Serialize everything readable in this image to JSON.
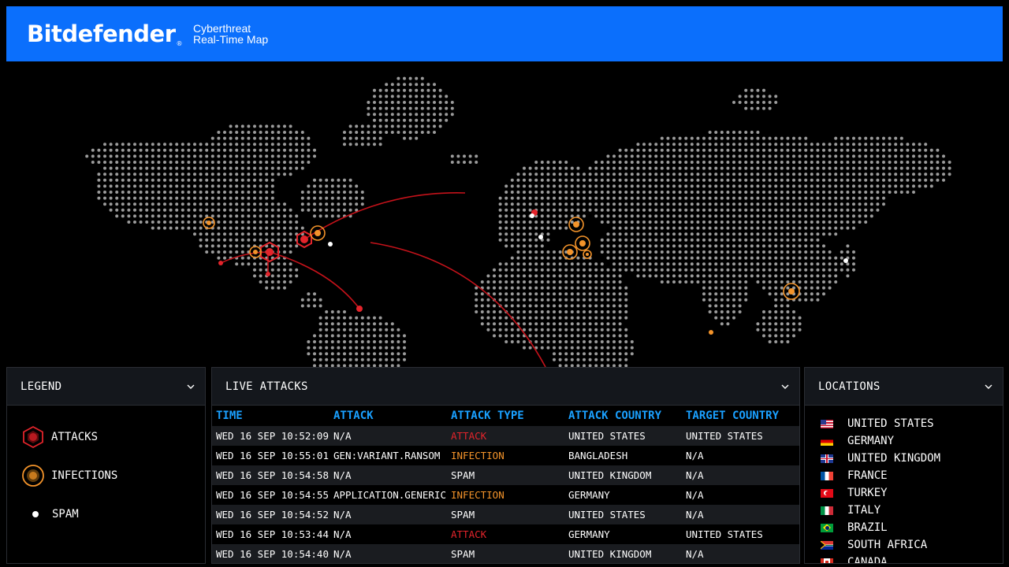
{
  "header": {
    "logo": "Bitdefender",
    "subtitle_line1": "Cyberthreat",
    "subtitle_line2": "Real-Time Map"
  },
  "legend": {
    "title": "LEGEND",
    "items": [
      {
        "label": "ATTACKS",
        "color": "#e3242b"
      },
      {
        "label": "INFECTIONS",
        "color": "#f3932a"
      },
      {
        "label": "SPAM",
        "color": "#ffffff"
      }
    ]
  },
  "live_attacks": {
    "title": "LIVE ATTACKS",
    "columns": [
      "TIME",
      "ATTACK",
      "ATTACK TYPE",
      "ATTACK COUNTRY",
      "TARGET COUNTRY"
    ],
    "rows": [
      {
        "time": "WED 16 SEP 10:52:09",
        "attack": "N/A",
        "type": "ATTACK",
        "attack_country": "UNITED STATES",
        "target_country": "UNITED STATES"
      },
      {
        "time": "WED 16 SEP 10:55:01",
        "attack": "GEN:VARIANT.RANSOM",
        "type": "INFECTION",
        "attack_country": "BANGLADESH",
        "target_country": "N/A"
      },
      {
        "time": "WED 16 SEP 10:54:58",
        "attack": "N/A",
        "type": "SPAM",
        "attack_country": "UNITED KINGDOM",
        "target_country": "N/A"
      },
      {
        "time": "WED 16 SEP 10:54:55",
        "attack": "APPLICATION.GENERIC",
        "type": "INFECTION",
        "attack_country": "GERMANY",
        "target_country": "N/A"
      },
      {
        "time": "WED 16 SEP 10:54:52",
        "attack": "N/A",
        "type": "SPAM",
        "attack_country": "UNITED STATES",
        "target_country": "N/A"
      },
      {
        "time": "WED 16 SEP 10:53:44",
        "attack": "N/A",
        "type": "ATTACK",
        "attack_country": "GERMANY",
        "target_country": "UNITED STATES"
      },
      {
        "time": "WED 16 SEP 10:54:40",
        "attack": "N/A",
        "type": "SPAM",
        "attack_country": "UNITED KINGDOM",
        "target_country": "N/A"
      }
    ]
  },
  "locations": {
    "title": "LOCATIONS",
    "items": [
      {
        "name": "UNITED STATES",
        "flag": "us-flag-icon"
      },
      {
        "name": "GERMANY",
        "flag": "de-flag-icon"
      },
      {
        "name": "UNITED KINGDOM",
        "flag": "gb-flag-icon"
      },
      {
        "name": "FRANCE",
        "flag": "fr-flag-icon"
      },
      {
        "name": "TURKEY",
        "flag": "tr-flag-icon"
      },
      {
        "name": "ITALY",
        "flag": "it-flag-icon"
      },
      {
        "name": "BRAZIL",
        "flag": "br-flag-icon"
      },
      {
        "name": "SOUTH AFRICA",
        "flag": "za-flag-icon"
      },
      {
        "name": "CANADA",
        "flag": "ca-flag-icon"
      }
    ]
  },
  "colors": {
    "brand": "#0b6ffc",
    "attack": "#e3242b",
    "infection": "#f3932a",
    "spam": "#ffffff",
    "column_header": "#1aa0ff"
  }
}
